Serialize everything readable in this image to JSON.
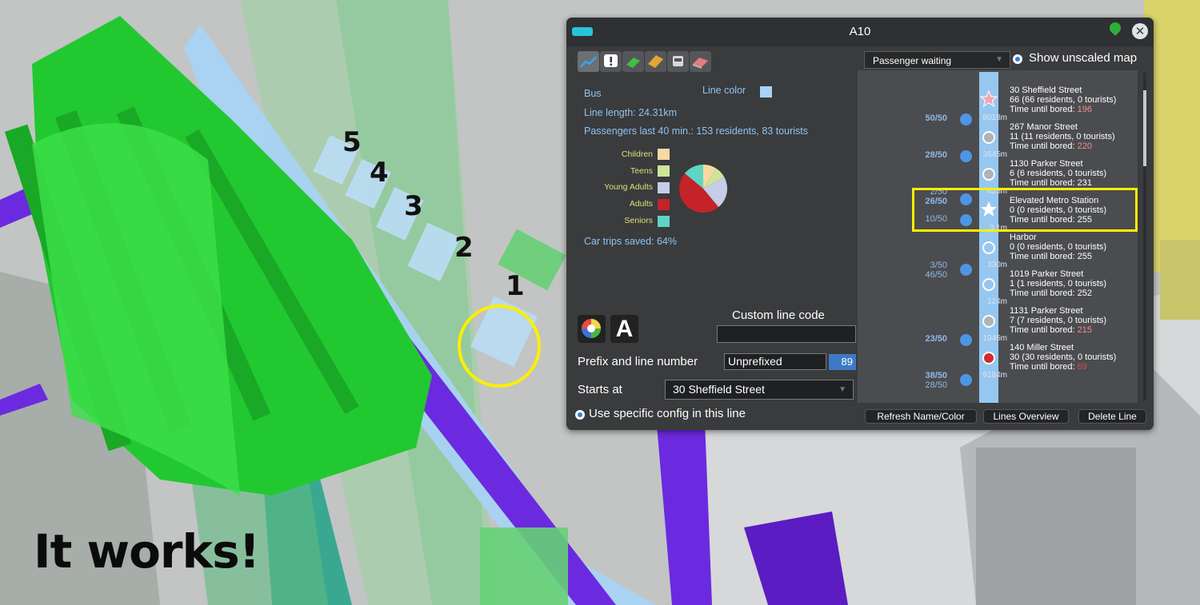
{
  "overlay": {
    "numbers": [
      "5",
      "4",
      "3",
      "2",
      "1"
    ],
    "caption": "It works!",
    "highlight_color": "#ffee00"
  },
  "panel": {
    "title": "A10",
    "close_icon": "✕",
    "tabs": [
      "chart-icon",
      "alert-icon",
      "money-icon",
      "ticket-icon",
      "vehicle-icon",
      "eraser-icon"
    ],
    "info": {
      "type": "Bus",
      "line_color_label": "Line color",
      "line_color": "#a7d3f7",
      "line_length": "Line length: 24.31km",
      "passengers": "Passengers last 40 min.: 153 residents, 83 tourists",
      "car_trips": "Car trips saved: 64%"
    },
    "age_groups": [
      {
        "label": "Children",
        "color": "#f7d9a1",
        "share": 0.09
      },
      {
        "label": "Teens",
        "color": "#cfe59a",
        "share": 0.08
      },
      {
        "label": "Young Adults",
        "color": "#c5cde7",
        "share": 0.22
      },
      {
        "label": "Adults",
        "color": "#c42328",
        "share": 0.47
      },
      {
        "label": "Seniors",
        "color": "#5fd5c5",
        "share": 0.14
      }
    ],
    "custom_code_label": "Custom line code",
    "custom_code_value": "",
    "prefix_label": "Prefix and line number",
    "prefix_value": "Unprefixed",
    "line_number": "89",
    "starts_at_label": "Starts at",
    "starts_at_value": "30 Sheffield Street",
    "use_config_label": "Use specific config in this line",
    "map_mode": "Passenger waiting",
    "show_unscaled": "Show unscaled map",
    "buttons": {
      "refresh": "Refresh Name/Color",
      "overview": "Lines Overview",
      "delete": "Delete Line"
    },
    "stops": [
      {
        "name": "30 Sheffield Street",
        "detail": "66 (66 residents, 0 tourists)",
        "bored_label": "Time until bored:",
        "bored": "196",
        "bored_color": "#f28d8d",
        "marker": "star-pink",
        "dist": "8018m"
      },
      {
        "name": "267 Manor Street",
        "detail": "11 (11 residents, 0 tourists)",
        "bored_label": "Time until bored:",
        "bored": "220",
        "bored_color": "#f28d8d",
        "marker": "grey",
        "dist": "3645m"
      },
      {
        "name": "1130 Parker Street",
        "detail": "6 (6 residents, 0 tourists)",
        "bored_label": "Time until bored:",
        "bored": "231",
        "bored_color": "#ffffff",
        "marker": "grey",
        "dist": "423m"
      },
      {
        "name": "Elevated Metro Station",
        "detail": "0 (0 residents, 0 tourists)",
        "bored_label": "Time until bored:",
        "bored": "255",
        "bored_color": "#ffffff",
        "marker": "star-white",
        "dist": "3.1m"
      },
      {
        "name": "Harbor",
        "detail": "0 (0 residents, 0 tourists)",
        "bored_label": "Time until bored:",
        "bored": "255",
        "bored_color": "#ffffff",
        "marker": "blue",
        "dist": "330m"
      },
      {
        "name": "1019 Parker Street",
        "detail": "1 (1 residents, 0 tourists)",
        "bored_label": "Time until bored:",
        "bored": "252",
        "bored_color": "#ffffff",
        "marker": "blue",
        "dist": "124m"
      },
      {
        "name": "1131 Parker Street",
        "detail": "7 (7 residents, 0 tourists)",
        "bored_label": "Time until bored:",
        "bored": "215",
        "bored_color": "#f28d8d",
        "marker": "grey",
        "dist": "1946m"
      },
      {
        "name": "140 Miller Street",
        "detail": "30 (30 residents, 0 tourists)",
        "bored_label": "Time until bored:",
        "bored": "69",
        "bored_color": "#e24848",
        "marker": "red",
        "dist": "9184m"
      }
    ],
    "vehicles": [
      "50/50",
      "28/50",
      "2/50",
      "26/50",
      "10/50",
      "3/50",
      "46/50",
      "23/50",
      "38/50",
      "28/50"
    ]
  }
}
